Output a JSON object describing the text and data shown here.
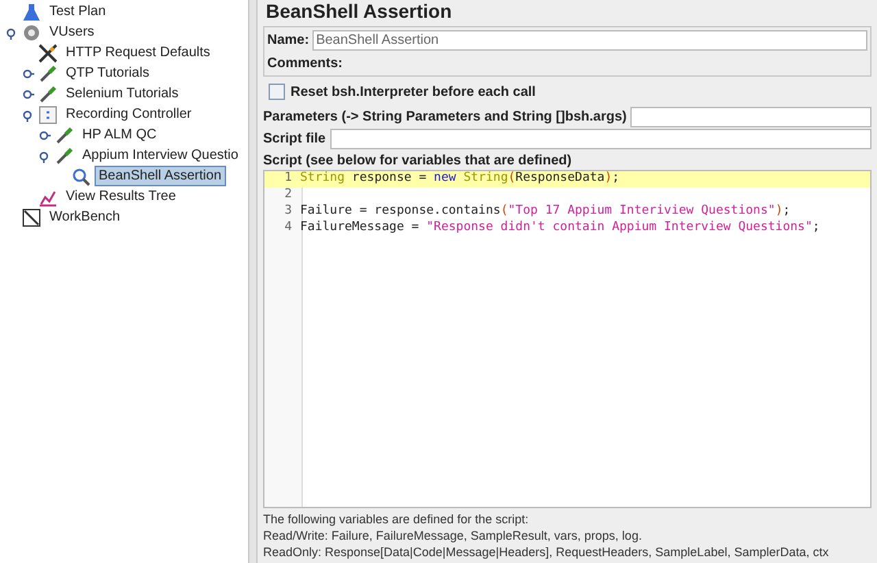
{
  "tree": [
    {
      "label": "Test Plan",
      "kind": "plan",
      "selected": false
    },
    {
      "label": "VUsers",
      "kind": "thread-group",
      "selected": false,
      "expanded": true,
      "children": [
        {
          "label": "HTTP Request Defaults",
          "kind": "config",
          "selected": false
        },
        {
          "label": "QTP Tutorials",
          "kind": "sampler",
          "selected": false,
          "expanded": false
        },
        {
          "label": "Selenium Tutorials",
          "kind": "sampler",
          "selected": false,
          "expanded": false
        },
        {
          "label": "Recording Controller",
          "kind": "controller",
          "selected": false,
          "expanded": true,
          "children": [
            {
              "label": "HP ALM QC",
              "kind": "sampler",
              "selected": false,
              "expanded": false
            },
            {
              "label": "Appium Interview Questio",
              "kind": "sampler",
              "selected": false,
              "expanded": true,
              "children": [
                {
                  "label": "BeanShell Assertion",
                  "kind": "assertion",
                  "selected": true
                }
              ]
            }
          ]
        },
        {
          "label": "View Results Tree",
          "kind": "listener",
          "selected": false
        }
      ]
    },
    {
      "label": "WorkBench",
      "kind": "workbench",
      "selected": false
    }
  ],
  "panel": {
    "title": "BeanShell Assertion",
    "name": {
      "label": "Name:",
      "value": "BeanShell Assertion"
    },
    "comments": {
      "label": "Comments:"
    },
    "reset": {
      "label": "Reset bsh.Interpreter before each call",
      "checked": false
    },
    "parameters": {
      "label": "Parameters (-> String Parameters and String []bsh.args)"
    },
    "script_file": {
      "label": "Script file"
    },
    "script_label": "Script (see below for variables that are defined)",
    "code": [
      {
        "number": "1",
        "highlighted": true,
        "tokens": [
          {
            "kind": "type",
            "text": "String"
          },
          {
            "kind": "plain",
            "text": " response = "
          },
          {
            "kind": "keyword",
            "text": "new"
          },
          {
            "kind": "type",
            "text": " String"
          },
          {
            "kind": "bracket",
            "text": "("
          },
          {
            "kind": "plain",
            "text": "ResponseData"
          },
          {
            "kind": "bracket",
            "text": ")"
          },
          {
            "kind": "plain",
            "text": ";"
          }
        ]
      },
      {
        "number": "2",
        "highlighted": false
      },
      {
        "number": "3",
        "highlighted": false,
        "tokens": [
          {
            "kind": "plain",
            "text": "Failure = response.contains"
          },
          {
            "kind": "bracket",
            "text": "("
          },
          {
            "kind": "string",
            "text": "\"Top 17 Appium Interiview Questions\""
          },
          {
            "kind": "bracket",
            "text": ")"
          },
          {
            "kind": "plain",
            "text": ";"
          }
        ]
      },
      {
        "number": "4",
        "highlighted": false,
        "tokens": [
          {
            "kind": "plain",
            "text": "FailureMessage = "
          },
          {
            "kind": "string",
            "text": "\"Response didn't contain Appium Interview Questions\""
          },
          {
            "kind": "plain",
            "text": ";"
          }
        ]
      }
    ],
    "notes": [
      "The following variables are defined for the script:",
      "Read/Write: Failure, FailureMessage, SampleResult, vars, props, log.",
      "ReadOnly: Response[Data|Code|Message|Headers], RequestHeaders, SampleLabel, SamplerData, ctx"
    ]
  }
}
